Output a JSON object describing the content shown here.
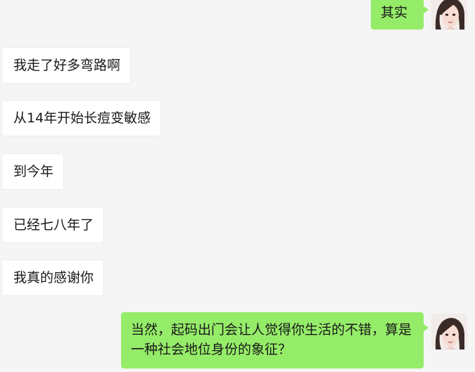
{
  "conversation": {
    "messages": [
      {
        "side": "out",
        "text": "其实"
      },
      {
        "side": "in",
        "text": "我走了好多弯路啊"
      },
      {
        "side": "in",
        "text": "从14年开始长痘变敏感"
      },
      {
        "side": "in",
        "text": "到今年"
      },
      {
        "side": "in",
        "text": "已经七八年了"
      },
      {
        "side": "in",
        "text": "我真的感谢你"
      },
      {
        "side": "out",
        "text": "当然，起码出门会让人觉得你生活的不错，算是一种社会地位身份的象征？"
      }
    ]
  },
  "colors": {
    "background": "#f5f5f5",
    "outgoing_bubble": "#95ec69",
    "incoming_bubble": "#ffffff"
  },
  "icons": {
    "self_avatar": "user-avatar-photo"
  }
}
